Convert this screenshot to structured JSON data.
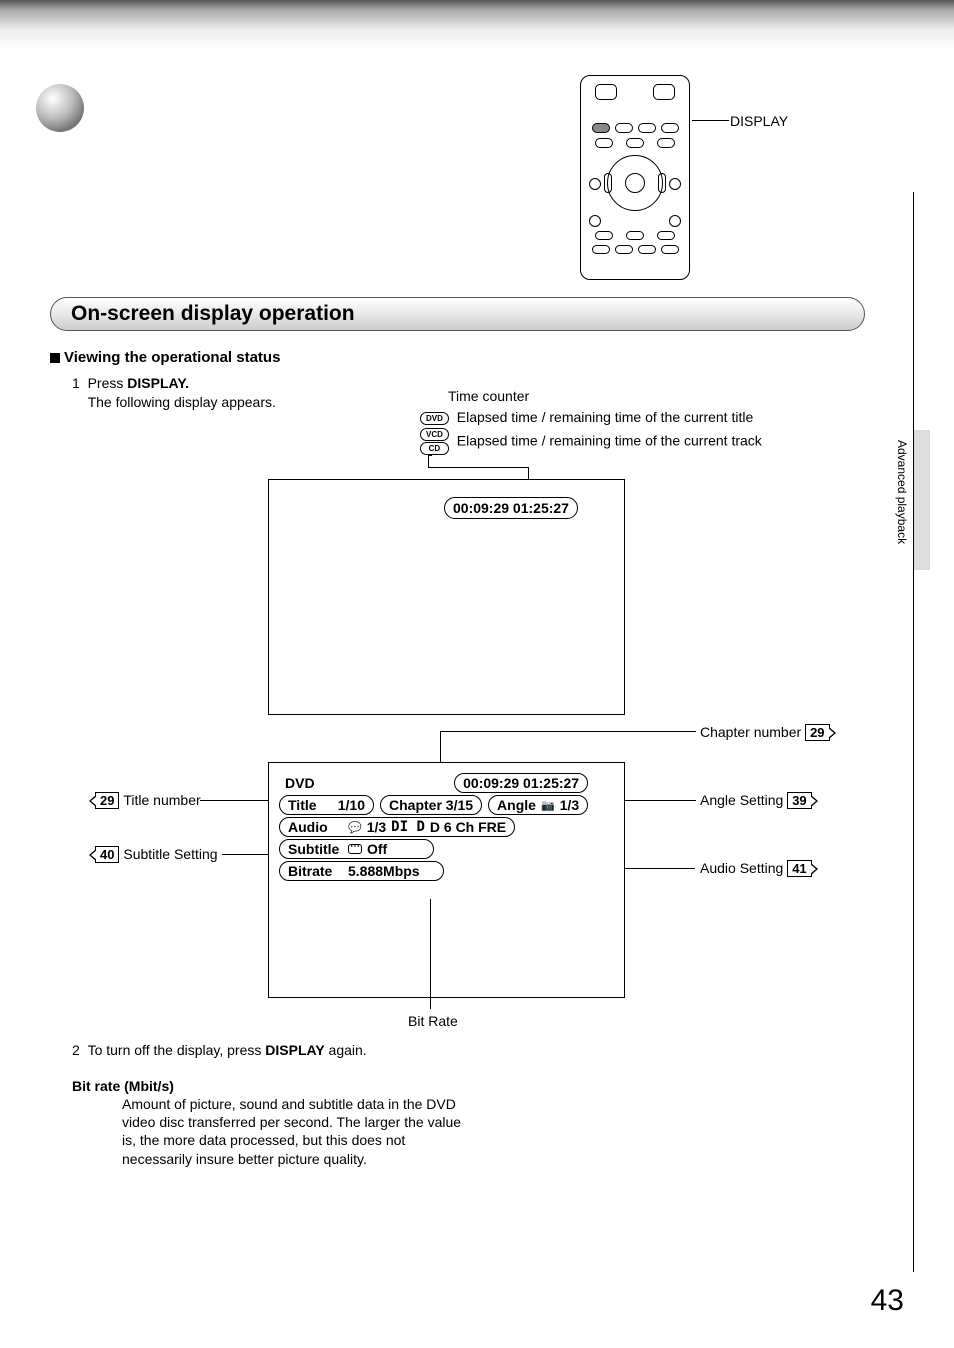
{
  "remote_label": "DISPLAY",
  "section_title": "On-screen display operation",
  "subheading": "Viewing the operational status",
  "step1_num": "1",
  "step1_a": "Press ",
  "step1_b": "DISPLAY.",
  "step1_c": "The following display appears.",
  "time_counter_label": "Time counter",
  "badge_dvd": "DVD",
  "badge_vcd": "VCD",
  "badge_cd": "CD",
  "elapsed_title": "Elapsed time / remaining time of the current title",
  "elapsed_track": "Elapsed time / remaining time of the current track",
  "time_display": "00:09:29  01:25:27",
  "osd": {
    "dvd_label": "DVD",
    "time": "00:09:29  01:25:27",
    "title_label": "Title",
    "title_val": "1/10",
    "chapter_label": "Chapter 3/15",
    "angle_label": "Angle",
    "angle_val": "1/3",
    "audio_label": "Audio",
    "audio_val1": "1/3",
    "audio_val2": "D 6 Ch FRE",
    "subtitle_label": "Subtitle",
    "subtitle_val": "Off",
    "bitrate_label": "Bitrate",
    "bitrate_val": "5.888Mbps"
  },
  "callouts": {
    "title_number": "Title number",
    "subtitle_setting": "Subtitle Setting",
    "chapter_number": "Chapter number",
    "angle_setting": "Angle Setting",
    "audio_setting": "Audio Setting",
    "bit_rate": "Bit Rate"
  },
  "refs": {
    "p29a": "29",
    "p29b": "29",
    "p39": "39",
    "p40": "40",
    "p41": "41"
  },
  "step2_num": "2",
  "step2_a": "To turn off the display, press ",
  "step2_b": "DISPLAY",
  "step2_c": " again.",
  "bitrate_heading": "Bit rate (Mbit/s)",
  "bitrate_body": "Amount of picture, sound and subtitle data in the DVD video disc transferred per second. The larger the value is, the more data processed, but this does not necessarily insure better picture quality.",
  "side_text": "Advanced playback",
  "page_number": "43",
  "dolby_digital": "DI D"
}
